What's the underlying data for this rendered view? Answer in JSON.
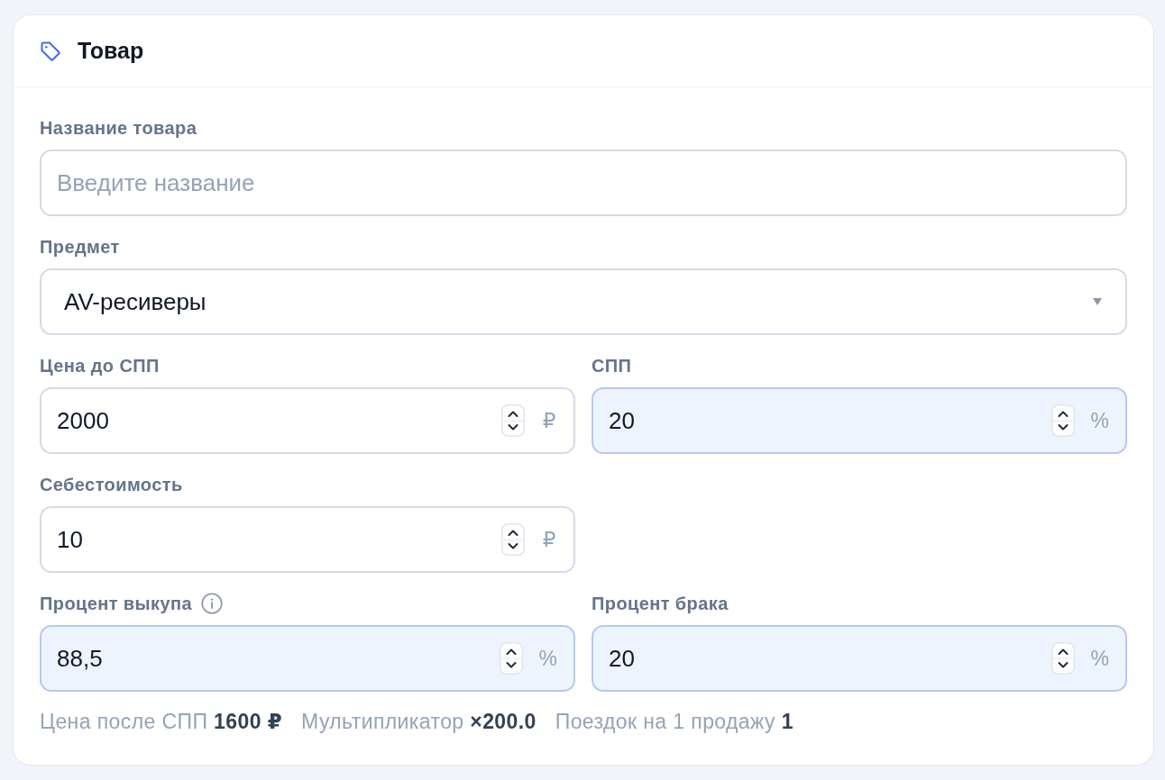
{
  "card": {
    "title": "Товар"
  },
  "rows": [
    [
      {
        "kind": "text",
        "label": "Название товара",
        "placeholder": "Введите название",
        "highlighted": false,
        "info": false
      }
    ],
    [
      {
        "kind": "select",
        "label": "Предмет",
        "value": "AV-ресиверы",
        "highlighted": false,
        "info": false
      }
    ],
    [
      {
        "kind": "number",
        "label": "Цена до СПП",
        "value": "2000",
        "unit": "₽",
        "highlighted": false,
        "info": false
      },
      {
        "kind": "number",
        "label": "СПП",
        "value": "20",
        "unit": "%",
        "highlighted": true,
        "info": false
      }
    ],
    [
      {
        "kind": "number",
        "label": "Себестоимость",
        "value": "10",
        "unit": "₽",
        "highlighted": false,
        "info": false
      }
    ],
    [
      {
        "kind": "number",
        "label": "Процент выкупа",
        "value": "88,5",
        "unit": "%",
        "highlighted": true,
        "info": true
      },
      {
        "kind": "number",
        "label": "Процент брака",
        "value": "20",
        "unit": "%",
        "highlighted": true,
        "info": false
      }
    ]
  ],
  "summary": [
    {
      "label": "Цена после СПП",
      "value": "1600 ₽"
    },
    {
      "label": "Мультипликатор",
      "value": "×200.0"
    },
    {
      "label": "Поездок на 1 продажу",
      "value": "1"
    }
  ]
}
